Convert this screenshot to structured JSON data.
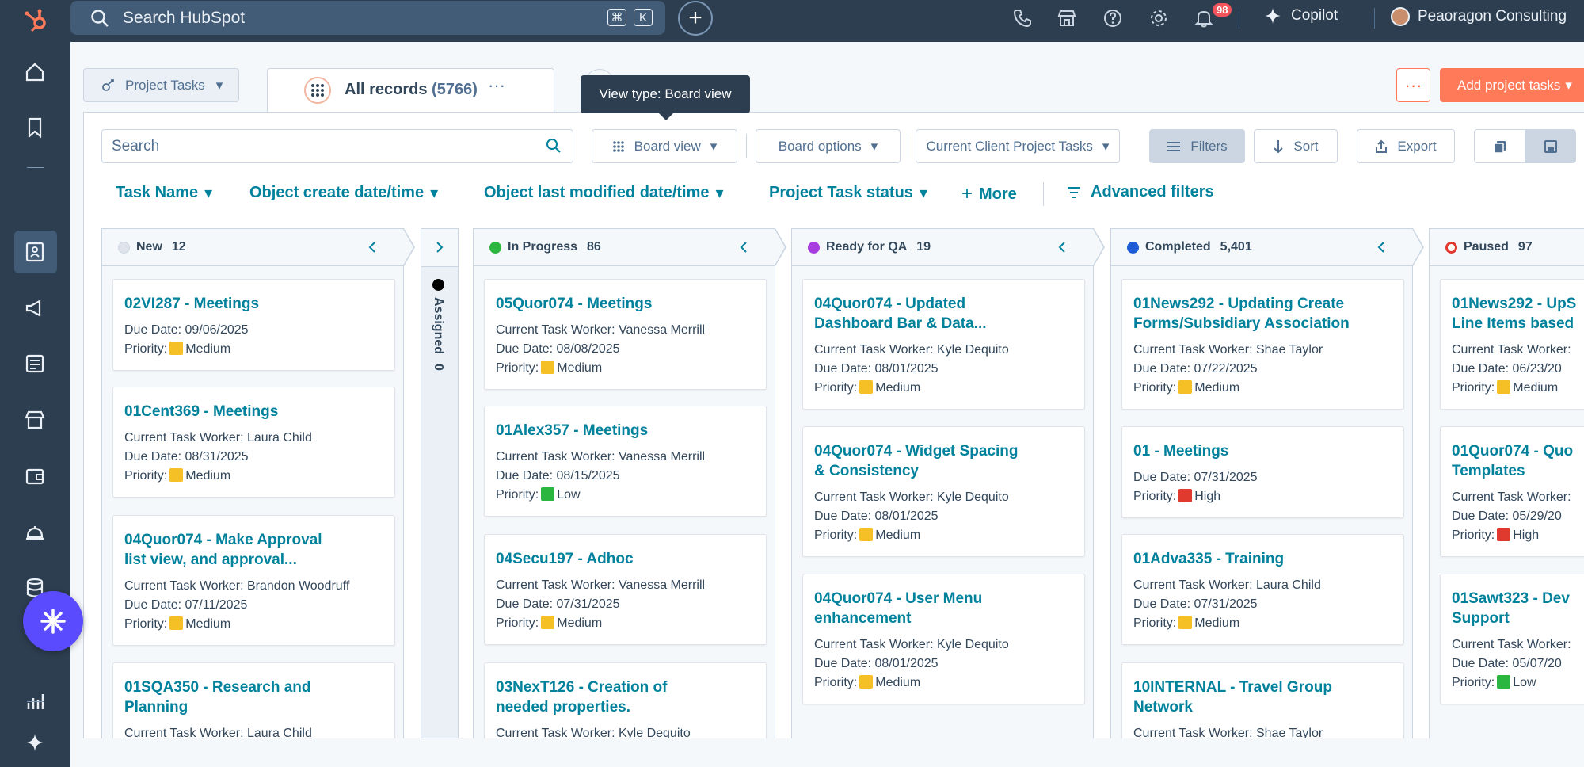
{
  "topbar": {
    "search_placeholder": "Search HubSpot",
    "shortcut_keys": [
      "⌘",
      "K"
    ],
    "notifications_count": "98",
    "copilot_label": "Copilot",
    "account_name": "Peaoragon Consulting"
  },
  "header": {
    "object_selector": "Project Tasks",
    "tab_title": "All records",
    "tab_count": "(5766)",
    "tooltip": "View type: Board view",
    "more_label": "···",
    "add_button": "Add project tasks"
  },
  "toolbar": {
    "search_placeholder": "Search",
    "view_button": "Board view",
    "board_options": "Board options",
    "saved_view": "Current Client Project Tasks",
    "filters": "Filters",
    "sort": "Sort",
    "export": "Export"
  },
  "filters": {
    "items": [
      "Task Name",
      "Object create date/time",
      "Object last modified date/time",
      "Project Task status",
      "More"
    ],
    "advanced": "Advanced filters"
  },
  "colors": {
    "accent": "#ff7a59",
    "link": "#00819c",
    "nav": "#2d3e50",
    "priority_medium": "#f5c026",
    "priority_low": "#2bb63f",
    "priority_high": "#e03a2f"
  },
  "board": {
    "columns": [
      {
        "name": "New",
        "count": "12",
        "dot": "#dfe3eb",
        "cards": [
          {
            "title": [
              "02VI287 - Meetings"
            ],
            "lines": [
              "Due Date: 09/06/2025"
            ],
            "priority": "Medium"
          },
          {
            "title": [
              "01Cent369 - Meetings"
            ],
            "lines": [
              "Current Task Worker: Laura Child",
              "Due Date: 08/31/2025"
            ],
            "priority": "Medium"
          },
          {
            "title": [
              "04Quor074 - Make Approval",
              "list view, and approval..."
            ],
            "lines": [
              "Current Task Worker: Brandon Woodruff",
              "Due Date: 07/11/2025"
            ],
            "priority": "Medium"
          },
          {
            "title": [
              "01SQA350 - Research and",
              "Planning"
            ],
            "lines": [
              "Current Task Worker: Laura Child"
            ],
            "priority": ""
          }
        ]
      },
      {
        "name": "In Progress",
        "count": "86",
        "dot": "#2bb63f",
        "cards": [
          {
            "title": [
              "05Quor074 - Meetings"
            ],
            "lines": [
              "Current Task Worker: Vanessa Merrill",
              "Due Date: 08/08/2025"
            ],
            "priority": "Medium"
          },
          {
            "title": [
              "01Alex357 - Meetings"
            ],
            "lines": [
              "Current Task Worker: Vanessa Merrill",
              "Due Date: 08/15/2025"
            ],
            "priority": "Low"
          },
          {
            "title": [
              "04Secu197 - Adhoc"
            ],
            "lines": [
              "Current Task Worker: Vanessa Merrill",
              "Due Date: 07/31/2025"
            ],
            "priority": "Medium"
          },
          {
            "title": [
              "03NexT126 - Creation of",
              "needed properties."
            ],
            "lines": [
              "Current Task Worker: Kyle Dequito"
            ],
            "priority": ""
          }
        ]
      },
      {
        "name": "Ready for QA",
        "count": "19",
        "dot": "#a83de0",
        "cards": [
          {
            "title": [
              "04Quor074 - Updated",
              "Dashboard Bar & Data..."
            ],
            "lines": [
              "Current Task Worker: Kyle Dequito",
              "Due Date: 08/01/2025"
            ],
            "priority": "Medium"
          },
          {
            "title": [
              "04Quor074 - Widget Spacing",
              "& Consistency"
            ],
            "lines": [
              "Current Task Worker: Kyle Dequito",
              "Due Date: 08/01/2025"
            ],
            "priority": "Medium"
          },
          {
            "title": [
              "04Quor074 - User Menu",
              "enhancement"
            ],
            "lines": [
              "Current Task Worker: Kyle Dequito",
              "Due Date: 08/01/2025"
            ],
            "priority": "Medium"
          }
        ]
      },
      {
        "name": "Completed",
        "count": "5,401",
        "dot": "#1d5cd4",
        "cards": [
          {
            "title": [
              "01News292 - Updating Create",
              "Forms/Subsidiary Association"
            ],
            "lines": [
              "Current Task Worker: Shae Taylor",
              "Due Date: 07/22/2025"
            ],
            "priority": "Medium"
          },
          {
            "title": [
              "01 - Meetings"
            ],
            "lines": [
              "Due Date: 07/31/2025"
            ],
            "priority": "High"
          },
          {
            "title": [
              "01Adva335 - Training"
            ],
            "lines": [
              "Current Task Worker: Laura Child",
              "Due Date: 07/31/2025"
            ],
            "priority": "Medium"
          },
          {
            "title": [
              "10INTERNAL - Travel Group",
              "Network"
            ],
            "lines": [
              "Current Task Worker: Shae Taylor"
            ],
            "priority": ""
          }
        ]
      },
      {
        "name": "Paused",
        "count": "97",
        "dot": "ring",
        "cards": [
          {
            "title": [
              "01News292 - UpS",
              "Line Items based"
            ],
            "lines": [
              "Current Task Worker:",
              "Due Date: 06/23/20"
            ],
            "priority": "Medium"
          },
          {
            "title": [
              "01Quor074 - Quo",
              "Templates"
            ],
            "lines": [
              "Current Task Worker:",
              "Due Date: 05/29/20"
            ],
            "priority": "High"
          },
          {
            "title": [
              "01Sawt323 - Dev",
              "Support"
            ],
            "lines": [
              "Current Task Worker:",
              "Due Date: 05/07/20"
            ],
            "priority": "Low"
          }
        ]
      }
    ],
    "collapsed": {
      "name": "Assigned",
      "count": "0"
    },
    "priority_label": "Priority:"
  }
}
